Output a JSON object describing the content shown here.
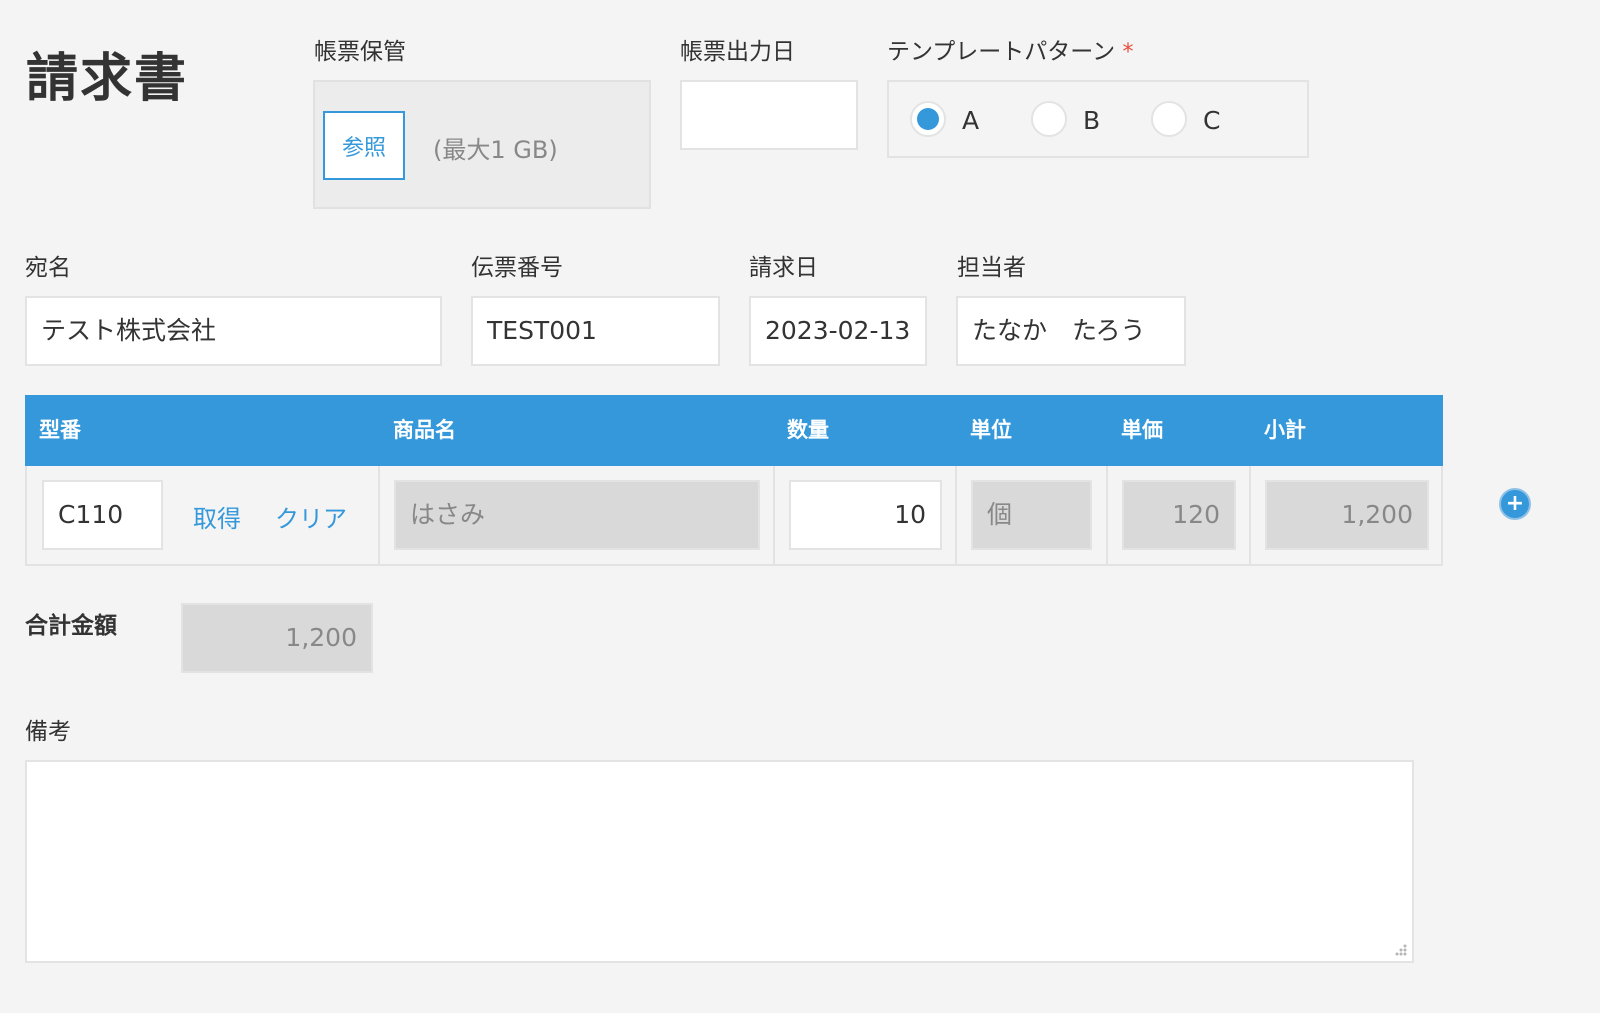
{
  "form": {
    "title": "請求書",
    "file_storage": {
      "label": "帳票保管",
      "browse_label": "参照",
      "size_limit": "(最大1 GB)"
    },
    "output_date": {
      "label": "帳票出力日",
      "value": ""
    },
    "template_pattern": {
      "label": "テンプレートパターン",
      "required_mark": "*",
      "options": [
        "A",
        "B",
        "C"
      ],
      "selected": "A"
    },
    "recipient": {
      "label": "宛名",
      "value": "テスト株式会社"
    },
    "slip_number": {
      "label": "伝票番号",
      "value": "TEST001"
    },
    "invoice_date": {
      "label": "請求日",
      "value": "2023-02-13"
    },
    "person_in_charge": {
      "label": "担当者",
      "value": "たなか　たろう"
    },
    "table": {
      "headers": {
        "model": "型番",
        "product": "商品名",
        "quantity": "数量",
        "unit": "単位",
        "unit_price": "単価",
        "subtotal": "小計"
      },
      "rows": [
        {
          "model": "C110",
          "fetch_label": "取得",
          "clear_label": "クリア",
          "product": "はさみ",
          "quantity": "10",
          "unit": "個",
          "unit_price": "120",
          "subtotal": "1,200"
        }
      ],
      "add_row_icon": "plus-circle-icon"
    },
    "total": {
      "label": "合計金額",
      "value": "1,200"
    },
    "remarks": {
      "label": "備考",
      "value": ""
    }
  },
  "colors": {
    "accent": "#3498db",
    "background": "#f4f4f4",
    "readonly_field": "#d8d9d8",
    "required": "#e74c3c"
  }
}
